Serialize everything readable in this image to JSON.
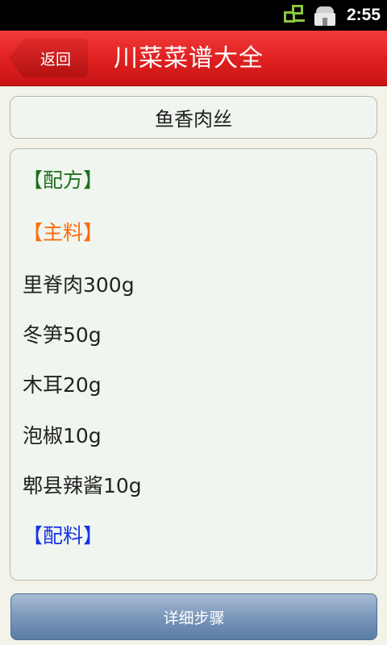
{
  "status_bar": {
    "time": "2:55",
    "icons": [
      "network-sync-icon",
      "android-market-icon"
    ]
  },
  "header": {
    "back_label": "返回",
    "title": "川菜菜谱大全",
    "colors": {
      "background": "#df1f1f"
    }
  },
  "recipe": {
    "name": "鱼香肉丝",
    "lines": [
      "【配方】",
      "【主料】",
      "里脊肉300g",
      "冬笋50g",
      "木耳20g",
      "泡椒10g",
      "郫县辣酱10g",
      "【配料】"
    ],
    "colors": {
      "section_formula": "#1f6f1f",
      "section_main": "#ff6a10",
      "section_extra": "#1433e6"
    }
  },
  "footer": {
    "steps_button_label": "详细步骤"
  }
}
